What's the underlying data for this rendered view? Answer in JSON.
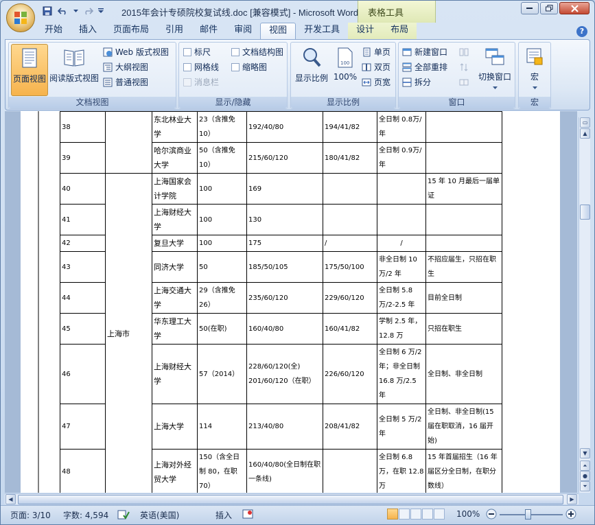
{
  "window": {
    "title": "2015年会计专硕院校复试线.doc [兼容模式] - Microsoft Word",
    "context_title": "表格工具"
  },
  "tabs": [
    "开始",
    "插入",
    "页面布局",
    "引用",
    "邮件",
    "审阅",
    "视图",
    "开发工具",
    "设计",
    "布局"
  ],
  "active_tab": "视图",
  "ribbon": {
    "doc_views": {
      "label": "文档视图",
      "print_layout": "页面视图",
      "full_screen_reading": "阅读版式视图",
      "web_layout": "Web 版式视图",
      "outline": "大纲视图",
      "draft": "普通视图"
    },
    "show_hide": {
      "label": "显示/隐藏",
      "ruler": "标尺",
      "gridlines": "网格线",
      "message_bar": "消息栏",
      "doc_map": "文档结构图",
      "thumbnails": "缩略图"
    },
    "zoom": {
      "label": "显示比例",
      "zoom": "显示比例",
      "percent": "100%",
      "one_page": "单页",
      "two_pages": "双页",
      "page_width": "页宽"
    },
    "window": {
      "label": "窗口",
      "new_window": "新建窗口",
      "arrange_all": "全部重排",
      "split": "拆分",
      "switch_windows": "切换窗口"
    },
    "macros": {
      "label": "宏",
      "macros": "宏"
    }
  },
  "table": {
    "rows": [
      {
        "no": "38",
        "school": "东北林业大学",
        "quota": "23（含推免10）",
        "score15": "192/40/80",
        "score14": "194/41/82",
        "tuition": "全日制 0.8万/年",
        "note": ""
      },
      {
        "no": "39",
        "school": "哈尔滨商业大学",
        "quota": "50（含推免10）",
        "score15": "215/60/120",
        "score14": "180/41/82",
        "tuition": "全日制 0.9万/年",
        "note": ""
      },
      {
        "no": "40",
        "school": "上海国家会计学院",
        "quota": "100",
        "score15": "169",
        "score14": "",
        "tuition": "",
        "note": "15 年 10 月最后一届单证"
      },
      {
        "no": "41",
        "school": "上海财经大学",
        "quota": "100",
        "score15": "130",
        "score14": "",
        "tuition": "",
        "note": ""
      },
      {
        "no": "42",
        "school": "复旦大学",
        "quota": "100",
        "score15": "175",
        "score14": "/",
        "tuition": "/",
        "note": ""
      },
      {
        "no": "43",
        "school": "同济大学",
        "quota": "50",
        "score15": "185/50/105",
        "score14": "175/50/100",
        "tuition": "非全日制 10万/2 年",
        "note": "不招应届生，只招在职生"
      },
      {
        "no": "44",
        "school": "上海交通大学",
        "quota": "29（含推免26）",
        "score15": "235/60/120",
        "score14": "229/60/120",
        "tuition": "全日制 5.8万/2-2.5 年",
        "note": "目前全日制"
      },
      {
        "no": "45",
        "school": "华东理工大学",
        "quota": "50(在职)",
        "score15": "160/40/80",
        "score14": "160/41/82",
        "tuition": "学制 2.5 年，12.8 万",
        "note": "只招在职生"
      },
      {
        "no": "46",
        "school": "上海财经大学",
        "quota": "57（2014）",
        "score15": "228/60/120(全) 201/60/120（在职）",
        "score14": "226/60/120",
        "tuition": "全日制 6 万/2 年；非全日制 16.8 万/2.5 年",
        "note": "全日制、非全日制"
      },
      {
        "no": "47",
        "school": "上海大学",
        "quota": "114",
        "score15": "213/40/80",
        "score14": "208/41/82",
        "tuition": "全日制 5 万/2 年",
        "note": "全日制、非全日制(15 届在职取消，16 届开始)"
      },
      {
        "no": "48",
        "school": "上海对外经贸大学",
        "quota": "150（含全日制 80，在职 70）",
        "score15": "160/40/80(全日制在职 一条线)",
        "score14": "",
        "tuition": "全日制 6.8万，在职 12.8 万",
        "note": "15 年首届招生（16 年届区分全日制，在职分数线）"
      }
    ],
    "region_shanghai": "上海市"
  },
  "status": {
    "page": "页面: 3/10",
    "words": "字数: 4,594",
    "language": "英语(美国)",
    "mode": "插入",
    "zoom": "100%"
  }
}
